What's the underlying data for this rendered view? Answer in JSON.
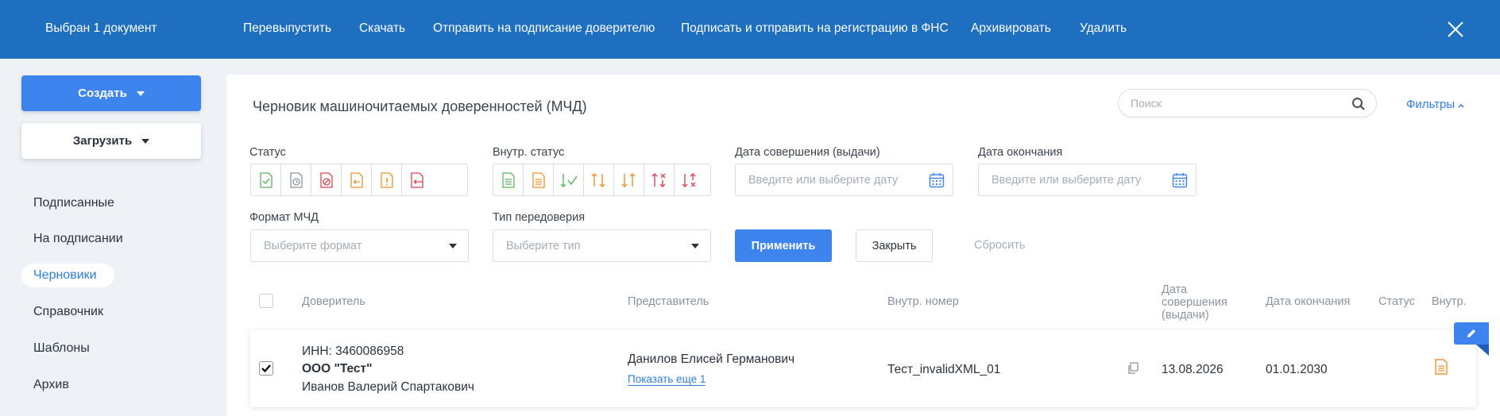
{
  "topbar": {
    "selected": "Выбран 1 документ",
    "actions": [
      "Перевыпустить",
      "Скачать",
      "Отправить на подписание доверителю",
      "Подписать и отправить на регистрацию в ФНС",
      "Архивировать",
      "Удалить"
    ]
  },
  "sidebar": {
    "create_label": "Создать",
    "upload_label": "Загрузить",
    "items": [
      "Подписанные",
      "На подписании",
      "Черновики",
      "Справочник",
      "Шаблоны",
      "Архив"
    ],
    "active": "Черновики"
  },
  "main": {
    "title": "Черновик машиночитаемых доверенностей (МЧД)",
    "search_placeholder": "Поиск",
    "filters_label": "Фильтры"
  },
  "filters": {
    "status_label": "Статус",
    "inner_status_label": "Внутр. статус",
    "date_issue_label": "Дата совершения (выдачи)",
    "date_end_label": "Дата окончания",
    "date_placeholder": "Введите или выберите дату",
    "format_label": "Формат МЧД",
    "format_placeholder": "Выберите формат",
    "type_label": "Тип передоверия",
    "type_placeholder": "Выберите тип",
    "apply_label": "Применить",
    "close_label": "Закрыть",
    "reset_label": "Сбросить"
  },
  "table": {
    "headers": {
      "principal": "Доверитель",
      "representative": "Представитель",
      "inner_number": "Внутр. номер",
      "date_issue": "Дата совершения (выдачи)",
      "date_end": "Дата окончания",
      "status": "Статус",
      "inner": "Внутр."
    },
    "rows": [
      {
        "inn": "ИНН: 3460086958",
        "org": "ООО \"Тест\"",
        "person": "Иванов Валерий Спартакович",
        "representative": "Данилов Елисей Германович",
        "show_more": "Показать еще 1",
        "inner_number": "Тест_invalidXML_01",
        "date_issue": "13.08.2026",
        "date_end": "01.01.2030",
        "checked": true
      }
    ]
  },
  "colors": {
    "topbar": "#1f6fc0",
    "accent": "#3d84ee",
    "green": "#5bb55a",
    "orange": "#f0922c",
    "red": "#e0454f",
    "gray": "#8a93a0"
  }
}
